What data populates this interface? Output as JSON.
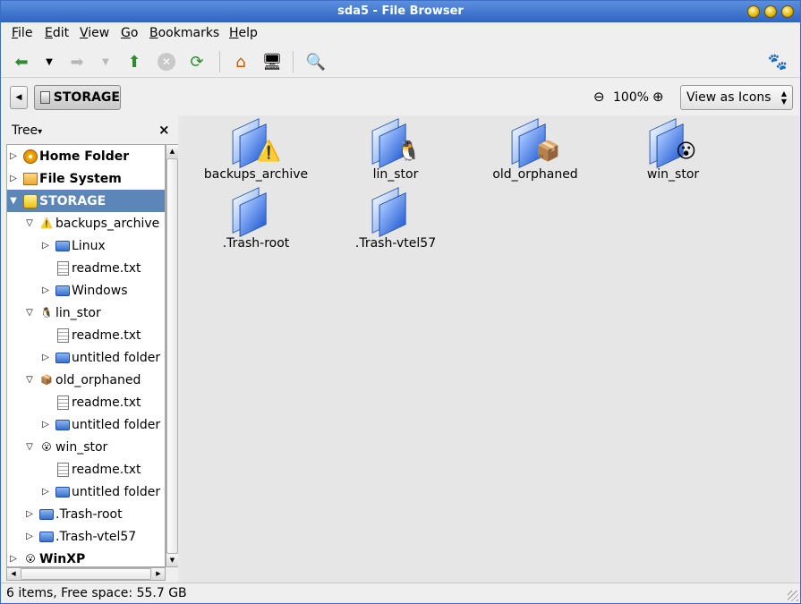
{
  "window": {
    "title": "sda5 - File Browser"
  },
  "menu": [
    "File",
    "Edit",
    "View",
    "Go",
    "Bookmarks",
    "Help"
  ],
  "location": {
    "current": "STORAGE",
    "zoom": "100%",
    "view_mode": "View as Icons"
  },
  "sidebar": {
    "title": "Tree",
    "rows": [
      {
        "label": "Home Folder",
        "bold": true
      },
      {
        "label": "File System",
        "bold": true
      },
      {
        "label": "STORAGE",
        "bold": true
      },
      {
        "label": "backups_archive"
      },
      {
        "label": "Linux"
      },
      {
        "label": "readme.txt"
      },
      {
        "label": "Windows"
      },
      {
        "label": "lin_stor"
      },
      {
        "label": "readme.txt"
      },
      {
        "label": "untitled folder"
      },
      {
        "label": "old_orphaned"
      },
      {
        "label": "readme.txt"
      },
      {
        "label": "untitled folder"
      },
      {
        "label": "win_stor"
      },
      {
        "label": "readme.txt"
      },
      {
        "label": "untitled folder"
      },
      {
        "label": ".Trash-root"
      },
      {
        "label": ".Trash-vtel57"
      },
      {
        "label": "WinXP",
        "bold": true
      }
    ]
  },
  "items": [
    {
      "name": "backups_archive",
      "emblem": "warning-icon"
    },
    {
      "name": "lin_stor",
      "emblem": "tux-icon"
    },
    {
      "name": "old_orphaned",
      "emblem": "package-icon"
    },
    {
      "name": "win_stor",
      "emblem": "scared-face-icon"
    },
    {
      "name": ".Trash-root",
      "emblem": ""
    },
    {
      "name": ".Trash-vtel57",
      "emblem": ""
    }
  ],
  "status": {
    "text": "6 items, Free space: 55.7 GB"
  },
  "colors": {
    "titlebar": "#2f64c2",
    "selection": "#5d86b8",
    "folder": "#3a6fd1"
  }
}
